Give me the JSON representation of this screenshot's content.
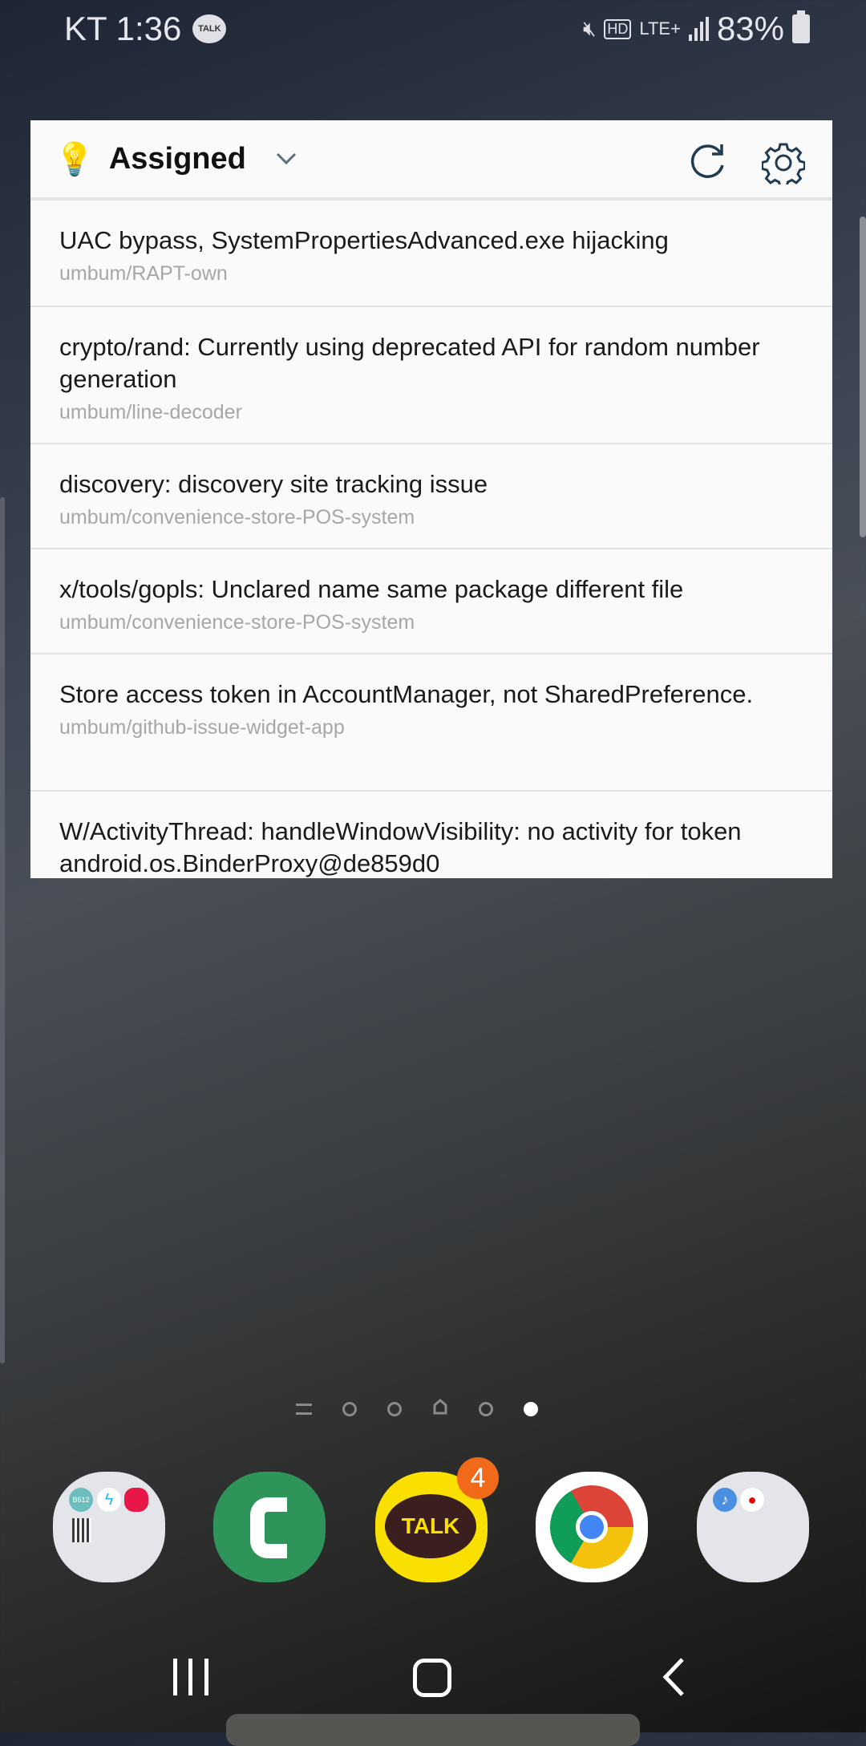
{
  "status_bar": {
    "carrier_time": "KT 1:36",
    "talk_notification": "TALK",
    "network": "LTE+",
    "hd": "HD",
    "battery": "83%"
  },
  "widget": {
    "title": "Assigned",
    "icons": [
      "lightbulb-icon",
      "chevron-down-icon",
      "refresh-icon",
      "gear-icon"
    ],
    "issues": [
      {
        "title": "UAC bypass, SystemPropertiesAdvanced.exe hijacking",
        "repo": "umbum/RAPT-own"
      },
      {
        "title": "crypto/rand: Currently using deprecated API for random number generation",
        "repo": "umbum/line-decoder"
      },
      {
        "title": "discovery: discovery site tracking issue",
        "repo": "umbum/convenience-store-POS-system"
      },
      {
        "title": "x/tools/gopls: Unclared name same package different file",
        "repo": "umbum/convenience-store-POS-system"
      },
      {
        "title": "Store access token in AccountManager, not SharedPreference.",
        "repo": "umbum/github-issue-widget-app"
      },
      {
        "title": "W/ActivityThread: handleWindowVisibility: no activity for token android.os.BinderProxy@de859d0",
        "repo": ""
      }
    ]
  },
  "page_indicator": {
    "pages": 6,
    "current": 6
  },
  "dock": {
    "kakaotalk_label": "TALK",
    "kakaotalk_badge": "4",
    "folder1_text": "B612"
  },
  "colors": {
    "phone": "#2e9459",
    "kakao": "#f9e000",
    "badge": "#f06a1a"
  }
}
